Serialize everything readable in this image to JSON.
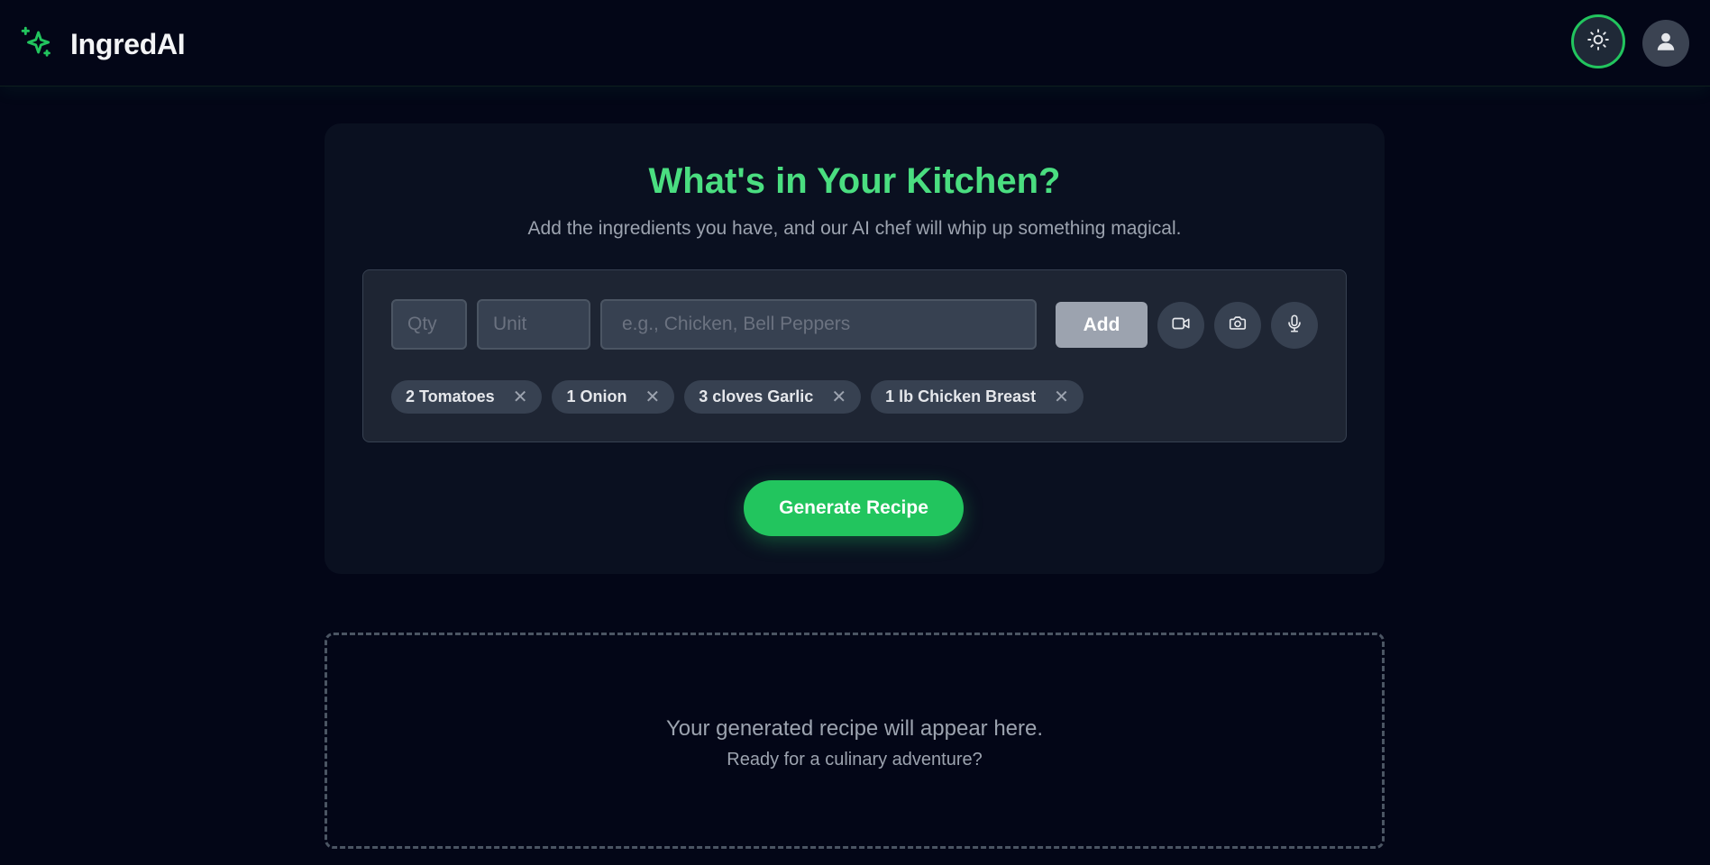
{
  "app": {
    "name": "IngredAI",
    "logo_icon": "sparkles-icon",
    "accent": "#22c55e"
  },
  "header": {
    "theme_icon": "sun-icon",
    "profile_icon": "user-icon"
  },
  "hero": {
    "title": "What's in Your Kitchen?",
    "subtitle": "Add the ingredients you have, and our AI chef will whip up something magical."
  },
  "form": {
    "qty_placeholder": "Qty",
    "unit_placeholder": "Unit",
    "name_placeholder": "e.g., Chicken, Bell Peppers",
    "add_label": "Add",
    "video_icon": "video-icon",
    "camera_icon": "camera-icon",
    "mic_icon": "microphone-icon"
  },
  "ingredients": [
    {
      "label": "2 Tomatoes"
    },
    {
      "label": "1 Onion"
    },
    {
      "label": "3 cloves Garlic"
    },
    {
      "label": "1 lb Chicken Breast"
    }
  ],
  "generate_label": "Generate Recipe",
  "output": {
    "message": "Your generated recipe will appear here.",
    "submessage": "Ready for a culinary adventure?"
  }
}
